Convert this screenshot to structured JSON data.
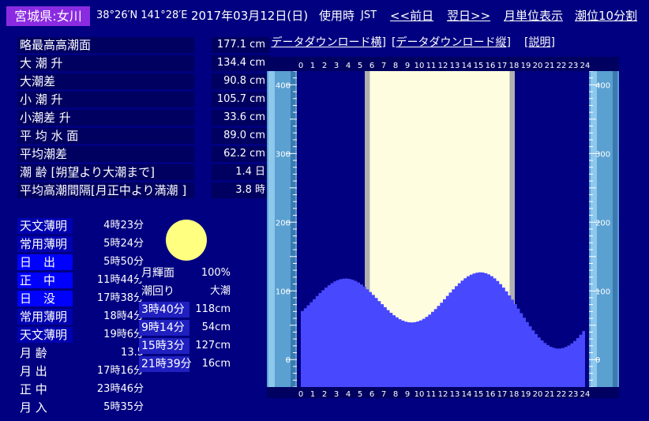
{
  "header": {
    "place": "宮城県:女川",
    "coords": "38°26′N 141°28′E",
    "date": "2017年03月12日(日)",
    "time_label": "使用時",
    "timezone": "JST",
    "prev_day": "<<前日",
    "next_day": "翌日>>",
    "month_view": "月単位表示",
    "ten_min": "潮位10分割"
  },
  "links": {
    "download_h": "[データダウンロード横]",
    "download_v": "[データダウンロード縦]",
    "explain": "[説明]"
  },
  "tide_stats": [
    {
      "label": "略最高高潮面",
      "value": "177.1 cm"
    },
    {
      "label": "大 潮 升",
      "value": "134.4 cm"
    },
    {
      "label": "大潮差",
      "value": "90.8 cm"
    },
    {
      "label": "小 潮 升",
      "value": "105.7 cm"
    },
    {
      "label": "小潮差 升",
      "value": "33.6 cm"
    },
    {
      "label": "平 均 水 面",
      "value": "89.0 cm"
    },
    {
      "label": "平均潮差",
      "value": "62.2 cm"
    },
    {
      "label": "潮 齢 [朔望より大潮まで]",
      "value": "1.4 日"
    },
    {
      "label": "平均高潮間隔[月正中より満潮 ]",
      "value": "3.8 時"
    }
  ],
  "sun_times": [
    {
      "label": "天文薄明",
      "value": "4時23分",
      "bg": "#0000b0"
    },
    {
      "label": "常用薄明",
      "value": "5時24分",
      "bg": "#0000b0"
    },
    {
      "label": "日　出",
      "value": "5時50分",
      "bg": "#0000ff"
    },
    {
      "label": "正　中",
      "value": "11時44分",
      "bg": "#0000ff"
    },
    {
      "label": "日　没",
      "value": "17時38分",
      "bg": "#0000ff"
    },
    {
      "label": "常用薄明",
      "value": "18時4分",
      "bg": "#0000b0"
    },
    {
      "label": "天文薄明",
      "value": "19時6分",
      "bg": "#0000b0"
    },
    {
      "label": "月 齢",
      "value": "13.5",
      "bg": "#000080"
    },
    {
      "label": "月 出",
      "value": "17時16分",
      "bg": "#000080"
    },
    {
      "label": "正 中",
      "value": "23時46分",
      "bg": "#000080"
    },
    {
      "label": "月 入",
      "value": "5時35分",
      "bg": "#000080"
    }
  ],
  "moon_info": [
    {
      "label": "月輝面",
      "value": "100%",
      "bg": "#000080"
    },
    {
      "label": "潮回り",
      "value": "大潮",
      "bg": "#000080"
    },
    {
      "label": "3時40分",
      "value": "118cm",
      "bg": "#2020c0"
    },
    {
      "label": "9時14分",
      "value": "54cm",
      "bg": "#2020c0"
    },
    {
      "label": "15時3分",
      "value": "127cm",
      "bg": "#2020c0"
    },
    {
      "label": "21時39分",
      "value": "16cm",
      "bg": "#2020c0"
    }
  ],
  "chart_data": {
    "type": "area",
    "x_ticks": [
      "0",
      "1",
      "2",
      "3",
      "4",
      "5",
      "6",
      "7",
      "8",
      "9",
      "10",
      "11",
      "12",
      "13",
      "14",
      "15",
      "16",
      "17",
      "18",
      "19",
      "20",
      "21",
      "22",
      "23",
      "24"
    ],
    "y_ticks": [
      "400",
      "300",
      "200",
      "100",
      "0"
    ],
    "ylim": [
      -40,
      420
    ],
    "xlim": [
      0,
      24
    ],
    "daylight": [
      5.83,
      17.63
    ],
    "twilight": [
      5.4,
      18.07
    ],
    "extremes": [
      {
        "time": 3.67,
        "height": 118
      },
      {
        "time": 9.23,
        "height": 54
      },
      {
        "time": 15.05,
        "height": 127
      },
      {
        "time": 21.65,
        "height": 16
      }
    ],
    "colors": {
      "fill": "#4848ff",
      "bg": "#000080",
      "day": "#fffde0",
      "twilight": "#b0b0b0",
      "gauge": "#5aa0d0"
    }
  }
}
